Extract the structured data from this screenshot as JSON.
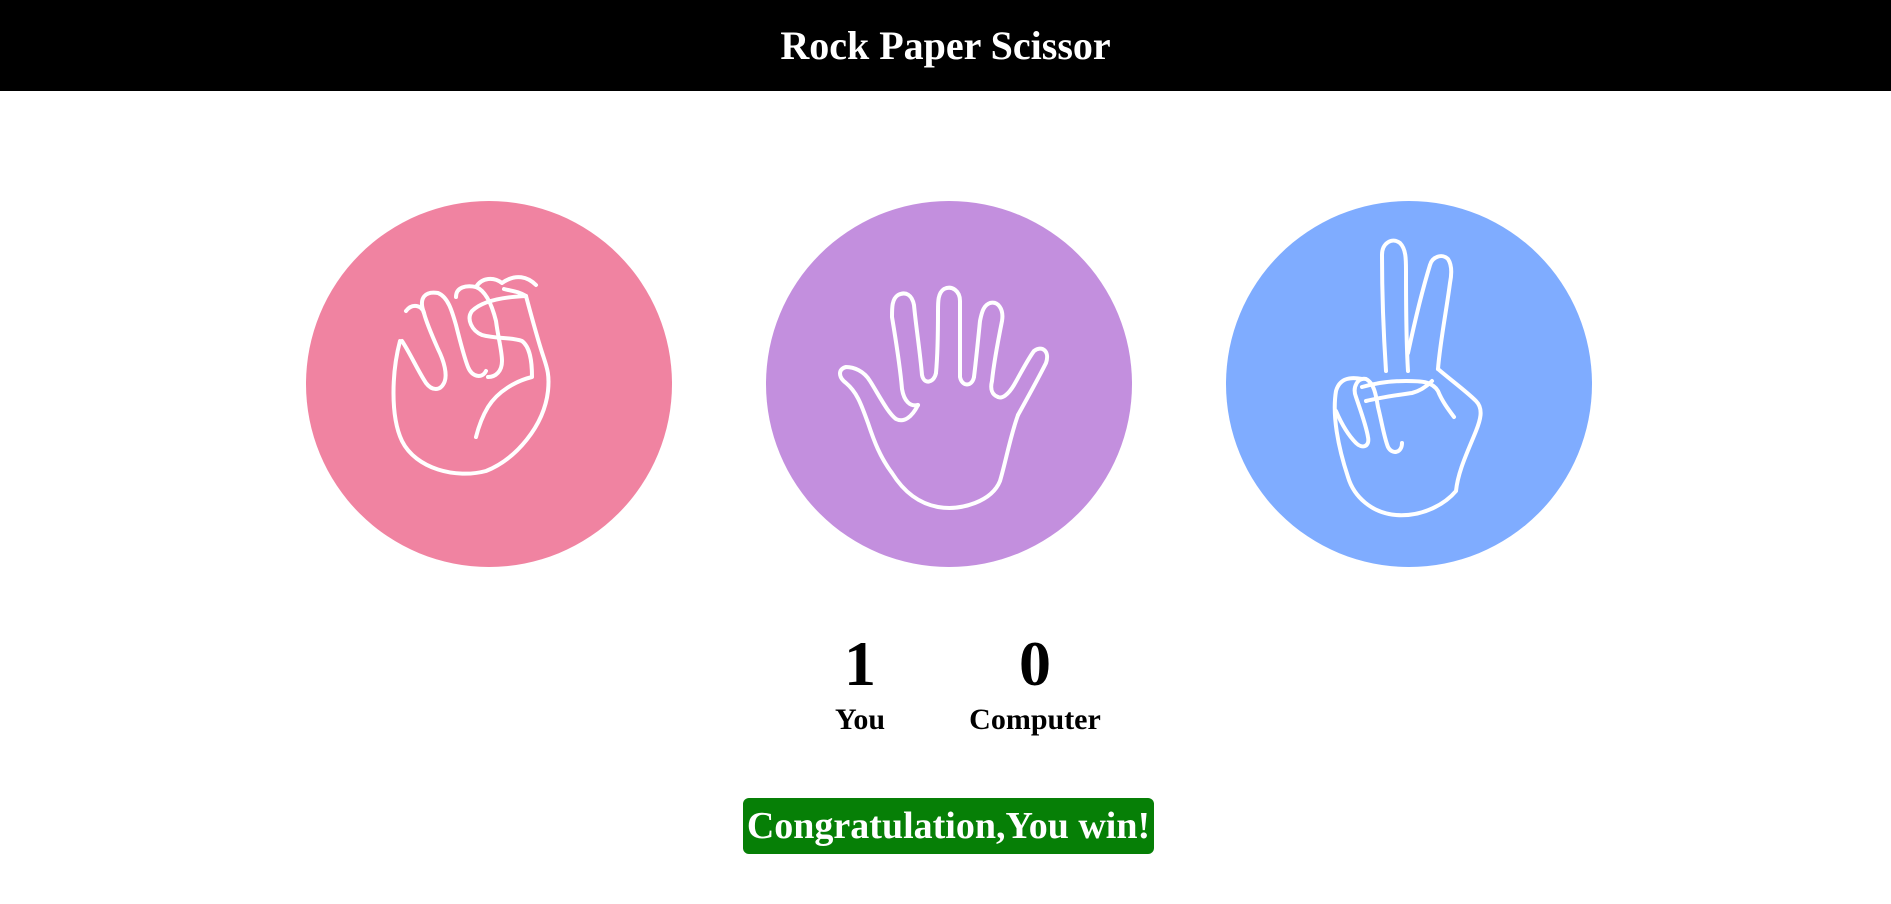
{
  "header": {
    "title": "Rock Paper Scissor",
    "background": "#000000",
    "color": "#ffffff"
  },
  "choices": [
    {
      "id": "rock",
      "icon": "fist-hand-icon",
      "color": "#f083a1"
    },
    {
      "id": "paper",
      "icon": "open-palm-hand-icon",
      "color": "#c38fde"
    },
    {
      "id": "scissor",
      "icon": "peace-sign-hand-icon",
      "color": "#7facff"
    }
  ],
  "score": {
    "user": {
      "value": "1",
      "label": "You"
    },
    "computer": {
      "value": "0",
      "label": "Computer"
    }
  },
  "message": {
    "text": "Congratulation,You win!",
    "background": "#067f06",
    "color": "#ffffff"
  }
}
